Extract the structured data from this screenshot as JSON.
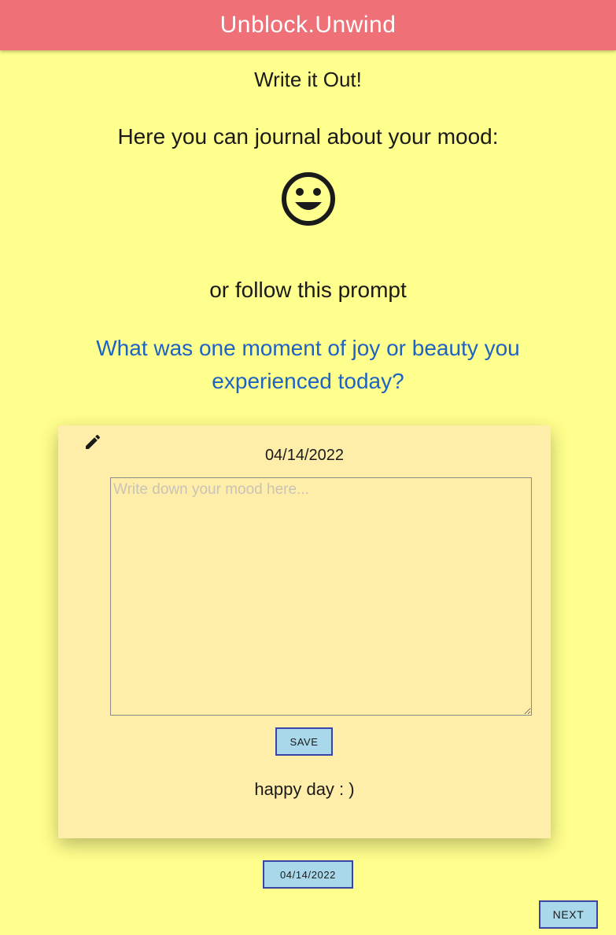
{
  "app": {
    "title": "Unblock.Unwind",
    "bar_color": "#f07078"
  },
  "page": {
    "heading": "Write it Out!",
    "journal_text": "Here you can journal about your mood:",
    "mood_icon": "smiley-face-icon",
    "or_text": "or follow this prompt",
    "prompt": "What was one moment of joy or beauty you experienced today?",
    "prompt_color": "#1e63c4",
    "background_color": "#ffff8d"
  },
  "card": {
    "edit_icon": "pencil-icon",
    "date": "04/14/2022",
    "textarea": {
      "value": "",
      "placeholder": "Write down your mood here..."
    },
    "save_label": "SAVE",
    "saved_entry": "happy day : )",
    "background_color": "#ffeeaa"
  },
  "footer": {
    "date_button_label": "04/14/2022",
    "next_label": "NEXT",
    "button_color": "#a8d8ea"
  }
}
